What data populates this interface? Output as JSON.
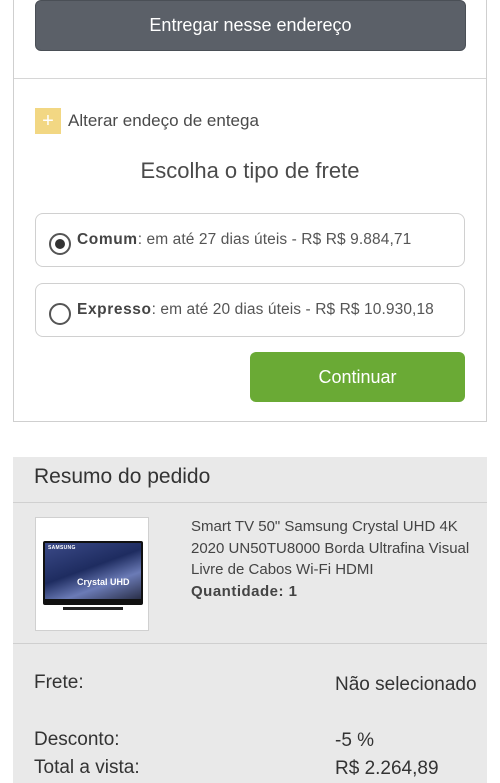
{
  "address": {
    "deliver_button": "Entregar nesse endereço"
  },
  "change_address": {
    "icon": "+",
    "label": "Alterar endeço de entega"
  },
  "freight": {
    "title": "Escolha o tipo de frete",
    "options": [
      {
        "name": "Comum",
        "detail": ": em até 27 dias úteis - R$ R$ 9.884,71",
        "selected": true
      },
      {
        "name": "Expresso",
        "detail": ": em até 20 dias úteis - R$ R$ 10.930,18",
        "selected": false
      }
    ],
    "continue_button": "Continuar"
  },
  "summary": {
    "title": "Resumo do pedido",
    "product": {
      "image_brand": "SAMSUNG",
      "image_logo": "Crystal UHD",
      "description": "Smart TV 50\" Samsung Crystal UHD 4K 2020 UN50TU8000 Borda Ultrafina Visual Livre de Cabos Wi-Fi HDMI",
      "quantity": "Quantidade: 1"
    },
    "rows": [
      {
        "label": "Frete:",
        "value": "Não selecionado"
      },
      {
        "label": "Desconto:",
        "value": "-5 %"
      },
      {
        "label": "Total a vista:",
        "value": "R$ 2.264,89"
      }
    ]
  },
  "colors": {
    "deliver_button": "#5b6068",
    "continue_button": "#6aaa35",
    "plus_box": "#f2d783",
    "summary_bg": "#e9e9e9"
  }
}
